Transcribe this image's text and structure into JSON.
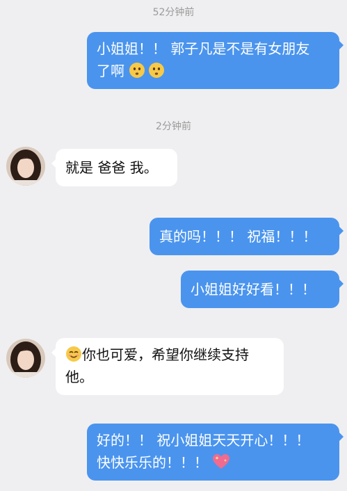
{
  "chat": {
    "timestamps": [
      "52分钟前",
      "2分钟前"
    ],
    "messages": [
      {
        "lines": [
          "小姐姐！！ 郭子凡是不是有女朋友",
          "了啊"
        ],
        "emoji": "anxious-face-emoji"
      },
      {
        "lines": [
          "就是 爸爸 我。"
        ]
      },
      {
        "lines": [
          "真的吗！！！ 祝福！！！"
        ]
      },
      {
        "lines": [
          "小姐姐好好看！！！"
        ]
      },
      {
        "lines": [
          "你也可爱，希望你继续支持",
          "他。"
        ],
        "emoji": "smiling-face-emoji"
      },
      {
        "lines": [
          "好的！！ 祝小姐姐天天开心！！！",
          "快快乐乐的！！！"
        ],
        "emoji": "sparkling-heart-emoji"
      }
    ]
  }
}
